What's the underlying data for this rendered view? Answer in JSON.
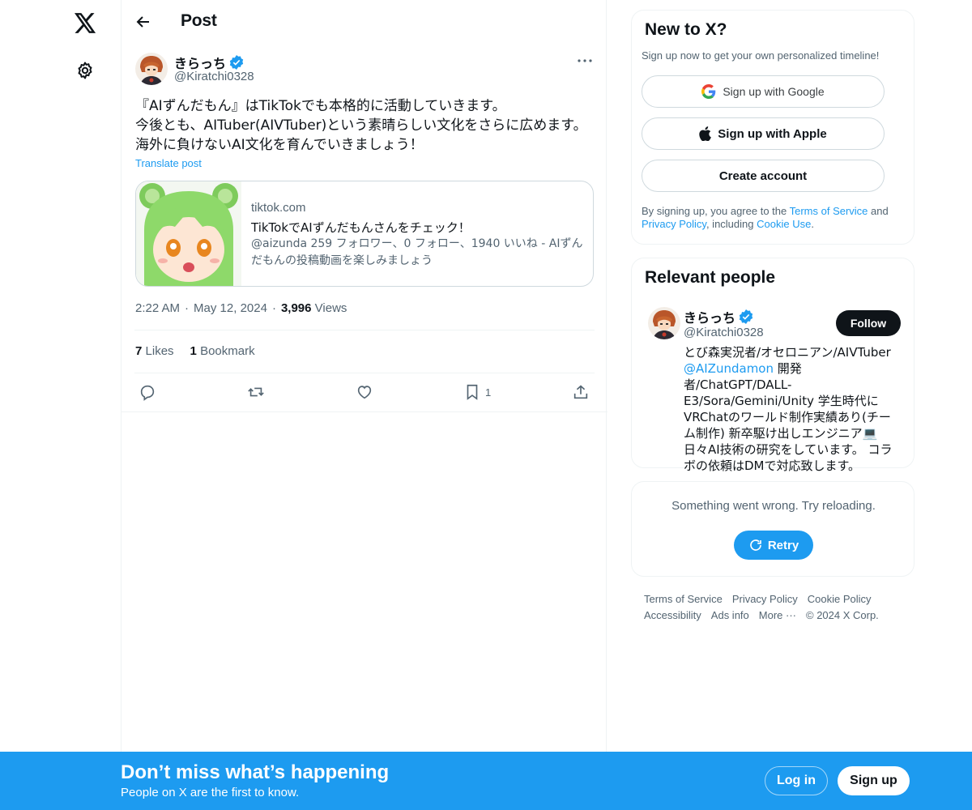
{
  "colors": {
    "accent": "#1d9bf0",
    "text": "#0f1419",
    "muted": "#536471",
    "border": "#eff3f4"
  },
  "nav": {
    "logo_icon": "x-logo-icon",
    "settings_icon": "gear-icon"
  },
  "header": {
    "title": "Post",
    "back_icon": "arrow-left-icon"
  },
  "post": {
    "author_name": "きらっち",
    "author_handle": "@Kiratchi0328",
    "text": "『AIずんだもん』はTikTokでも本格的に活動していきます。\n今後とも、AITuber(AIVTuber)という素晴らしい文化をさらに広めます。\n海外に負けないAI文化を育んでいきましょう！",
    "translate_label": "Translate post",
    "card": {
      "domain": "tiktok.com",
      "title": "TikTokでAIずんだもんさんをチェック！",
      "description": "@aizunda 259 フォロワー、0 フォロー、1940 いいね - AIずんだもんの投稿動画を楽しみましょう"
    },
    "time": "2:22 AM",
    "date": "May 12, 2024",
    "views_count": "3,996",
    "views_label": "Views",
    "likes_count": "7",
    "likes_label": "Likes",
    "bookmarks_count": "1",
    "bookmarks_label": "Bookmark",
    "bookmark_action_count": "1"
  },
  "signup": {
    "title": "New to X?",
    "subtitle": "Sign up now to get your own personalized timeline!",
    "google_label": "Sign up with Google",
    "apple_label": "Sign up with Apple",
    "create_label": "Create account",
    "legal_prefix": "By signing up, you agree to the ",
    "terms_link": "Terms of Service",
    "legal_and": " and ",
    "privacy_link": "Privacy Policy",
    "legal_including": ", including ",
    "cookie_link": "Cookie Use",
    "legal_end": "."
  },
  "relevant": {
    "title": "Relevant people",
    "name": "きらっち",
    "handle": "@Kiratchi0328",
    "follow_label": "Follow",
    "bio_before": "とび森実況者/オセロニアン/AIVTuber ",
    "bio_mention": "@AIZundamon",
    "bio_after": " 開発者/ChatGPT/DALL-E3/Sora/Gemini/Unity 学生時代にVRChatのワールド制作実績あり(チーム制作) 新卒駆け出しエンジニア💻 日々AI技術の研究をしています。 コラボの依頼はDMで対応致します。"
  },
  "error": {
    "message": "Something went wrong. Try reloading.",
    "retry_label": "Retry"
  },
  "footer": {
    "links": [
      "Terms of Service",
      "Privacy Policy",
      "Cookie Policy",
      "Accessibility",
      "Ads info",
      "More ···"
    ],
    "copyright": "© 2024 X Corp."
  },
  "banner": {
    "title": "Don’t miss what’s happening",
    "subtitle": "People on X are the first to know.",
    "login_label": "Log in",
    "signup_label": "Sign up"
  }
}
